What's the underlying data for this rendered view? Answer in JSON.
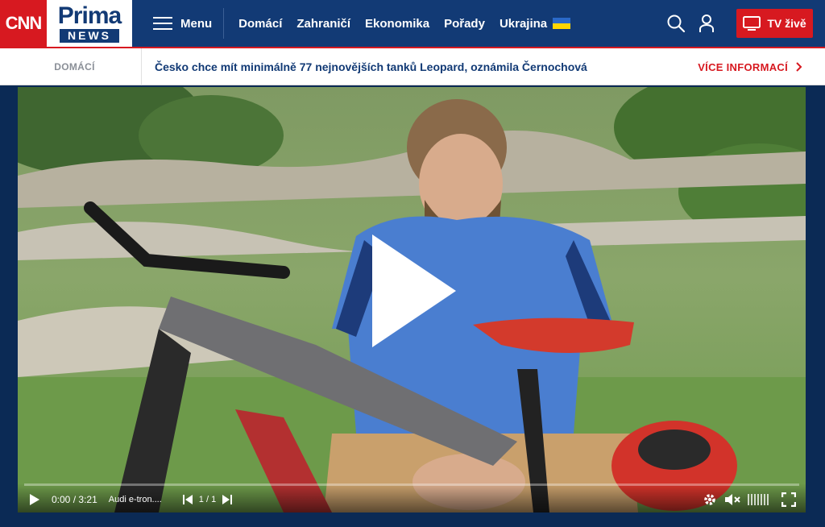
{
  "brand": {
    "cnn": "CNN",
    "prima": "Prima",
    "news": "NEWS"
  },
  "header": {
    "menu_label": "Menu",
    "nav": [
      {
        "label": "Domácí"
      },
      {
        "label": "Zahraničí"
      },
      {
        "label": "Ekonomika"
      },
      {
        "label": "Pořady"
      },
      {
        "label": "Ukrajina"
      }
    ],
    "search_icon": "search-icon",
    "user_icon": "user-icon",
    "tv_live_label": "TV živě"
  },
  "ticker": {
    "category": "DOMÁCÍ",
    "headline": "Česko chce mít minimálně 77 nejnovějších tanků Leopard, oznámila Černochová",
    "more_label": "VÍCE INFORMACÍ"
  },
  "player": {
    "current_time": "0:00",
    "separator": "/",
    "duration": "3:21",
    "title": "Audi e-tron....",
    "chapter": "1 / 1",
    "progress": 0,
    "icons": [
      "play-icon",
      "skip-back-icon",
      "skip-forward-icon",
      "settings-icon",
      "mute-icon",
      "fullscreen-icon"
    ]
  },
  "colors": {
    "nav_bg": "#123a75",
    "accent_red": "#d71920",
    "headline_blue": "#123a75"
  }
}
